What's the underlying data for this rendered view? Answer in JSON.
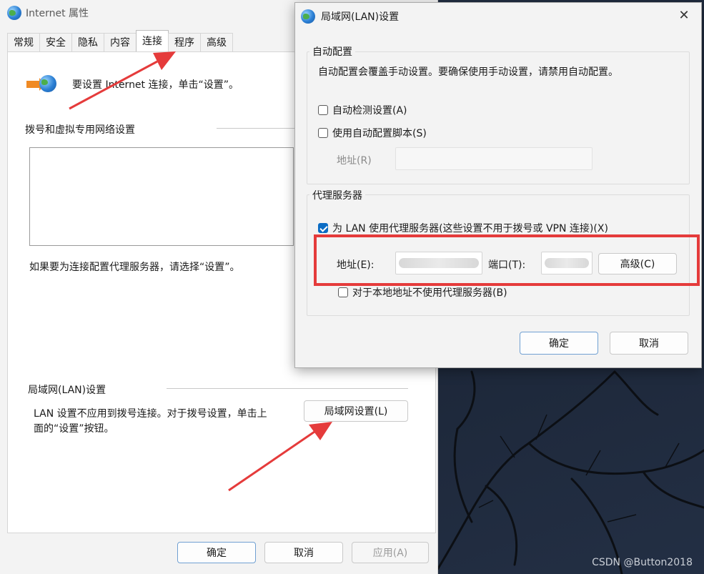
{
  "main_window": {
    "title": "Internet 属性",
    "tabs": [
      "常规",
      "安全",
      "隐私",
      "内容",
      "连接",
      "程序",
      "高级"
    ],
    "active_tab": "连接",
    "setup_text": "要设置 Internet 连接，单击“设置”。",
    "dialup_section_label": "拨号和虚拟专用网络设置",
    "proxy_hint": "如果要为连接配置代理服务器，请选择“设置”。",
    "lan_section_label": "局域网(LAN)设置",
    "lan_desc_line1": "LAN 设置不应用到拨号连接。对于拨号设置，单击上",
    "lan_desc_line2": "面的“设置”按钮。",
    "lan_button": "局域网设置(L)",
    "ok_button": "确定",
    "cancel_button": "取消",
    "apply_button": "应用(A)"
  },
  "lan_dialog": {
    "title": "局域网(LAN)设置",
    "auto_config_group": "自动配置",
    "auto_config_desc": "自动配置会覆盖手动设置。要确保使用手动设置，请禁用自动配置。",
    "auto_detect_label": "自动检测设置(A)",
    "auto_detect_checked": false,
    "use_script_label": "使用自动配置脚本(S)",
    "use_script_checked": false,
    "script_address_label": "地址(R)",
    "proxy_group": "代理服务器",
    "use_proxy_label": "为 LAN 使用代理服务器(这些设置不用于拨号或 VPN 连接)(X)",
    "use_proxy_checked": true,
    "address_label": "地址(E):",
    "port_label": "端口(T):",
    "advanced_button": "高级(C)",
    "bypass_local_label": "对于本地地址不使用代理服务器(B)",
    "bypass_local_checked": false,
    "ok_button": "确定",
    "cancel_button": "取消"
  },
  "watermark": "CSDN @Button2018",
  "colors": {
    "annotation_red": "#e53b3b",
    "checkbox_blue": "#0b6cc4"
  }
}
